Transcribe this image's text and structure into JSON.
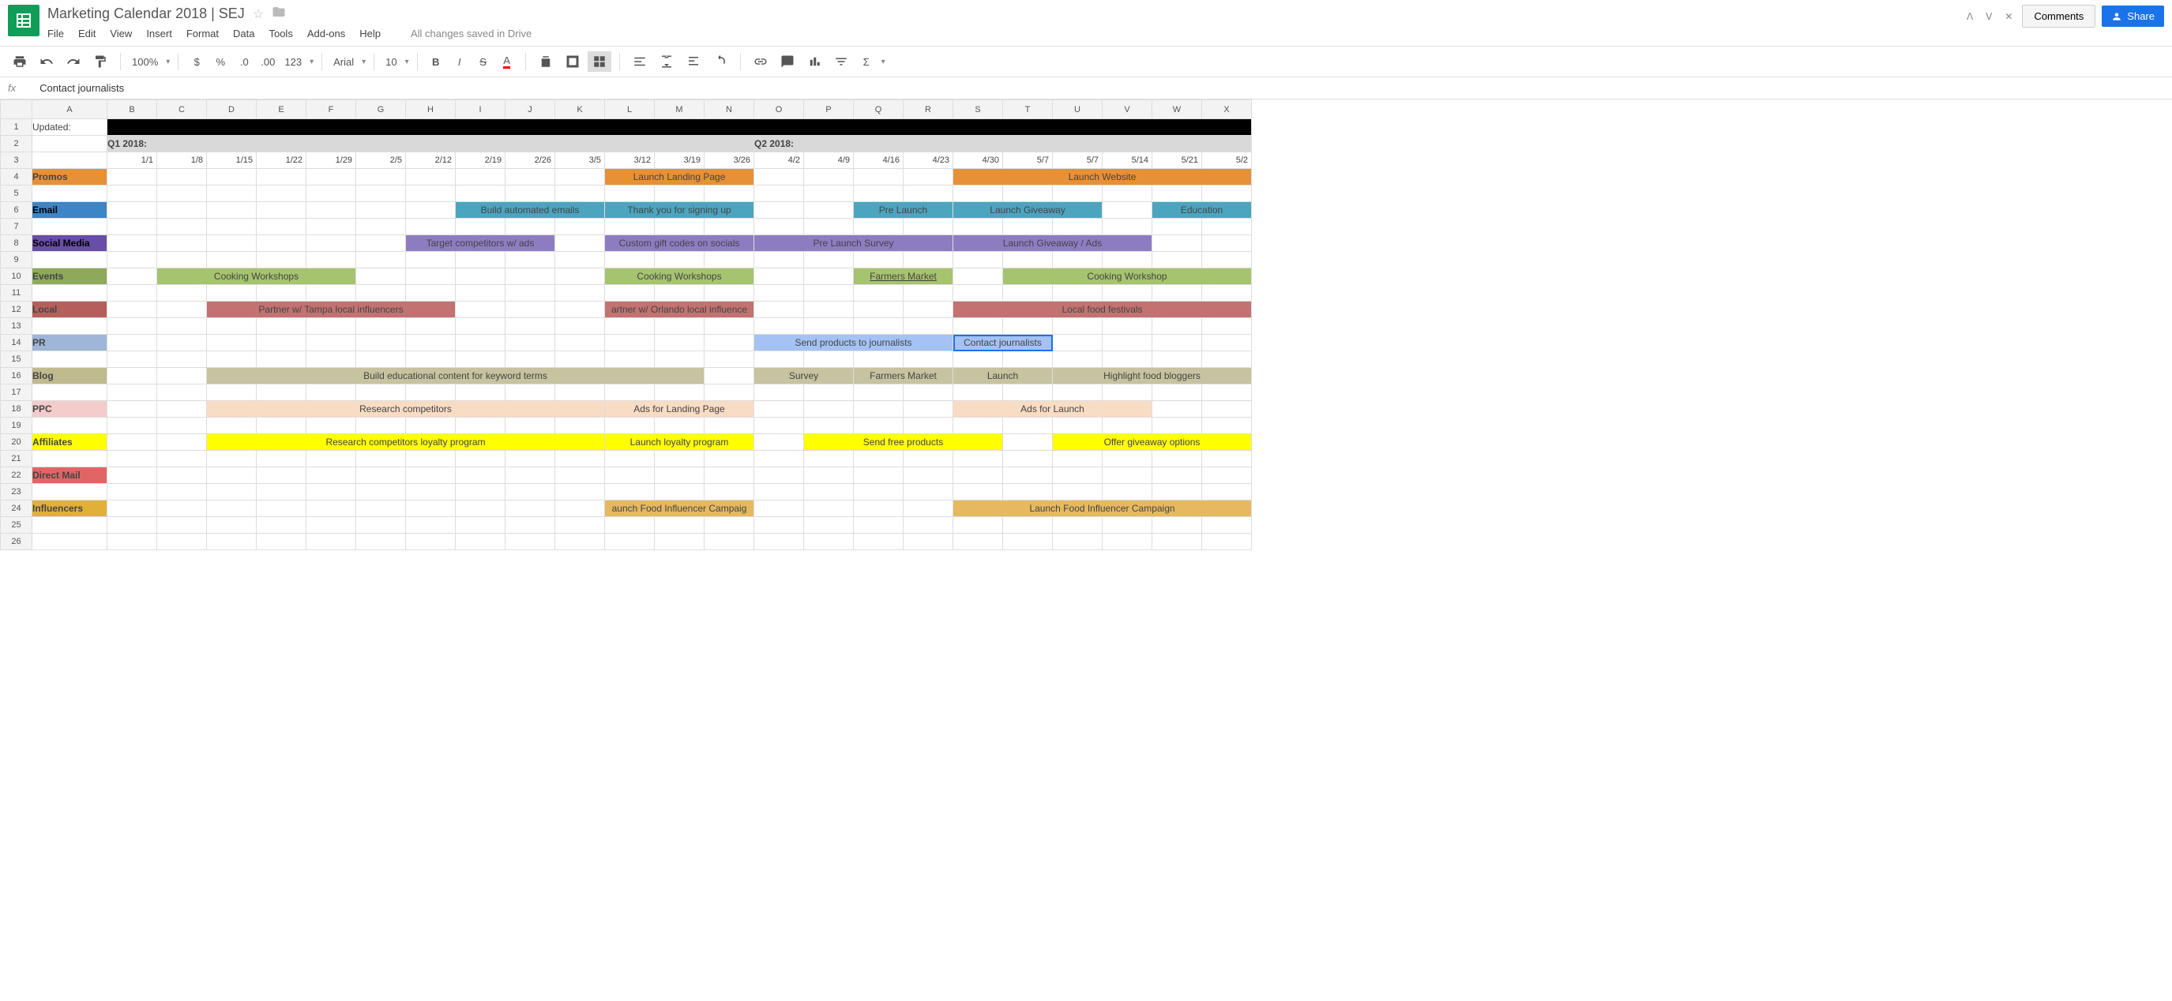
{
  "doc": {
    "title": "Marketing Calendar 2018 | SEJ",
    "save_status": "All changes saved in Drive",
    "comments_label": "Comments",
    "share_label": "Share"
  },
  "menu": {
    "file": "File",
    "edit": "Edit",
    "view": "View",
    "insert": "Insert",
    "format": "Format",
    "data": "Data",
    "tools": "Tools",
    "addons": "Add-ons",
    "help": "Help"
  },
  "toolbar": {
    "zoom": "100%",
    "font": "Arial",
    "font_size": "10",
    "numfmt": "123"
  },
  "formula": {
    "fx": "fx",
    "value": "Contact journalists"
  },
  "columns": [
    "A",
    "B",
    "C",
    "D",
    "E",
    "F",
    "G",
    "H",
    "I",
    "J",
    "K",
    "L",
    "M",
    "N",
    "O",
    "P",
    "Q",
    "R",
    "S",
    "T",
    "U",
    "V",
    "W",
    "X"
  ],
  "col_widths": {
    "A": 95,
    "default": 63
  },
  "rows": {
    "r1": {
      "A": "Updated:"
    },
    "r2": {
      "q1": "Q1 2018:",
      "q2": "Q2 2018:"
    },
    "dates": [
      "1/1",
      "1/8",
      "1/15",
      "1/22",
      "1/29",
      "2/5",
      "2/12",
      "2/19",
      "2/26",
      "3/5",
      "3/12",
      "3/19",
      "3/26",
      "4/2",
      "4/9",
      "4/16",
      "4/23",
      "4/30",
      "5/7",
      "5/7",
      "5/14",
      "5/21",
      "5/2"
    ],
    "categories": {
      "promos": "Promos",
      "email": "Email",
      "social": "Social Media",
      "events": "Events",
      "local": "Local",
      "pr": "PR",
      "blog": "Blog",
      "ppc": "PPC",
      "affiliates": "Affiliates",
      "direct": "Direct Mail",
      "influencers": "Influencers"
    },
    "bars": {
      "promos": [
        {
          "start": "L",
          "span": 3,
          "text": "Launch Landing Page"
        },
        {
          "start": "S",
          "span": 6,
          "text": "Launch Website"
        }
      ],
      "email": [
        {
          "start": "I",
          "span": 3,
          "text": "Build automated emails"
        },
        {
          "start": "L",
          "span": 3,
          "text": "Thank you for signing up"
        },
        {
          "start": "Q",
          "span": 2,
          "text": "Pre Launch"
        },
        {
          "start": "S",
          "span": 3,
          "text": "Launch Giveaway"
        },
        {
          "start": "W",
          "span": 2,
          "text": "Education"
        }
      ],
      "social": [
        {
          "start": "H",
          "span": 3,
          "text": "Target competitors w/ ads"
        },
        {
          "start": "L",
          "span": 3,
          "text": "Custom gift codes on socials"
        },
        {
          "start": "O",
          "span": 4,
          "text": "Pre Launch Survey"
        },
        {
          "start": "S",
          "span": 4,
          "text": "Launch Giveaway / Ads"
        }
      ],
      "events": [
        {
          "start": "C",
          "span": 4,
          "text": "Cooking Workshops"
        },
        {
          "start": "L",
          "span": 3,
          "text": "Cooking Workshops"
        },
        {
          "start": "Q",
          "span": 2,
          "text": "Farmers Market",
          "underline": true
        },
        {
          "start": "T",
          "span": 5,
          "text": "Cooking Workshop"
        }
      ],
      "local": [
        {
          "start": "D",
          "span": 5,
          "text": "Partner w/ Tampa local influencers"
        },
        {
          "start": "L",
          "span": 3,
          "text": "artner w/ Orlando local influence"
        },
        {
          "start": "S",
          "span": 6,
          "text": "Local food festivals"
        }
      ],
      "pr": [
        {
          "start": "O",
          "span": 4,
          "text": "Send products to journalists"
        },
        {
          "start": "S",
          "span": 2,
          "text": "Contact journalists",
          "selected": true
        }
      ],
      "blog": [
        {
          "start": "D",
          "span": 10,
          "text": "Build educational content for keyword terms"
        },
        {
          "start": "O",
          "span": 2,
          "text": "Survey"
        },
        {
          "start": "Q",
          "span": 2,
          "text": "Farmers Market"
        },
        {
          "start": "S",
          "span": 2,
          "text": "Launch"
        },
        {
          "start": "U",
          "span": 4,
          "text": "Highlight food bloggers"
        }
      ],
      "ppc": [
        {
          "start": "D",
          "span": 8,
          "text": "Research competitors"
        },
        {
          "start": "L",
          "span": 3,
          "text": "Ads for Landing Page"
        },
        {
          "start": "S",
          "span": 4,
          "text": "Ads for Launch"
        }
      ],
      "affiliates": [
        {
          "start": "D",
          "span": 8,
          "text": "Research competitors loyalty program"
        },
        {
          "start": "L",
          "span": 3,
          "text": "Launch loyalty program"
        },
        {
          "start": "P",
          "span": 4,
          "text": "Send free products"
        },
        {
          "start": "U",
          "span": 4,
          "text": "Offer giveaway options"
        }
      ],
      "influencers": [
        {
          "start": "L",
          "span": 3,
          "text": "aunch Food Influencer Campaig"
        },
        {
          "start": "S",
          "span": 6,
          "text": "Launch Food Influencer Campaign"
        }
      ]
    }
  }
}
